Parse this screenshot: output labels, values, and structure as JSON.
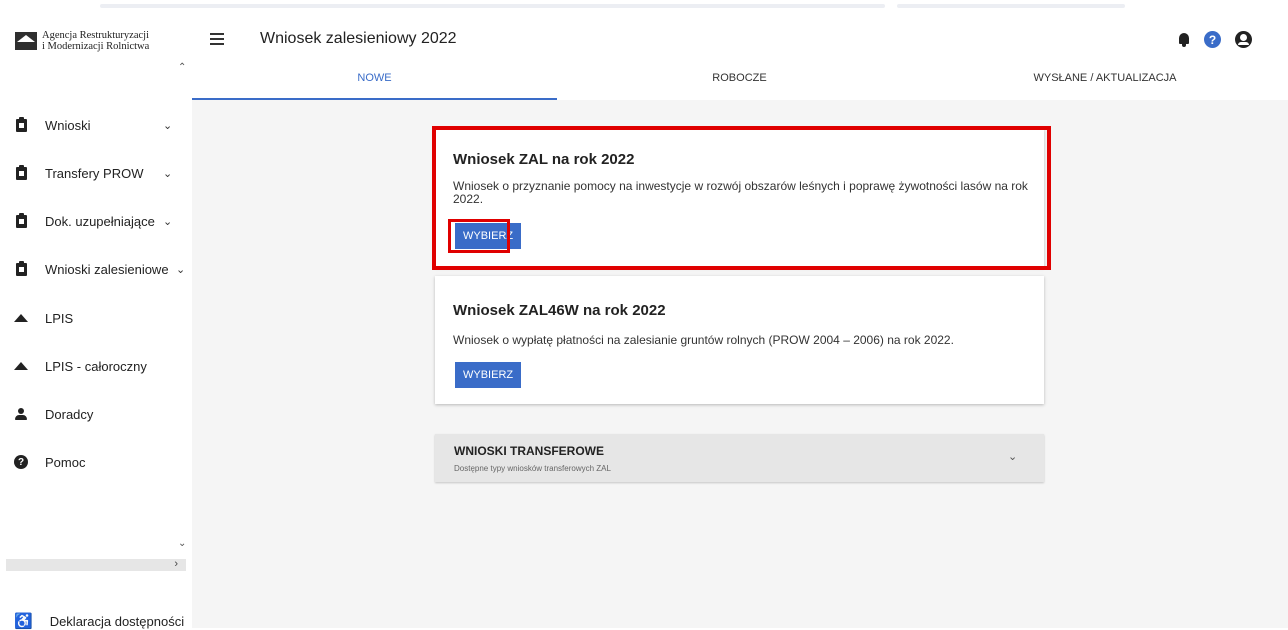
{
  "brand": {
    "line1": "Agencja Restrukturyzacji",
    "line2": "i Modernizacji Rolnictwa"
  },
  "header": {
    "title": "Wniosek zalesieniowy 2022"
  },
  "tabs": [
    {
      "label": "NOWE"
    },
    {
      "label": "ROBOCZE"
    },
    {
      "label": "WYSŁANE / AKTUALIZACJA"
    }
  ],
  "sidebar": {
    "items": [
      {
        "label": "Wnioski",
        "icon": "clipboard-icon"
      },
      {
        "label": "Transfery PROW",
        "icon": "clipboard-icon"
      },
      {
        "label": "Dok. uzupełniające",
        "icon": "clipboard-icon"
      },
      {
        "label": "Wnioski zalesieniowe",
        "icon": "clipboard-icon"
      },
      {
        "label": "LPIS",
        "icon": "mountain-icon"
      },
      {
        "label": "LPIS - całoroczny",
        "icon": "mountain-icon"
      },
      {
        "label": "Doradcy",
        "icon": "person-icon"
      },
      {
        "label": "Pomoc",
        "icon": "help-icon"
      }
    ],
    "accessibility": "Deklaracja dostępności"
  },
  "cards": [
    {
      "title": "Wniosek ZAL na rok 2022",
      "description": "Wniosek o przyznanie pomocy na inwestycje w rozwój obszarów leśnych i poprawę żywotności lasów na rok 2022.",
      "button": "WYBIERZ"
    },
    {
      "title": "Wniosek ZAL46W na rok 2022",
      "description": "Wniosek o wypłatę płatności na zalesianie gruntów rolnych (PROW 2004 – 2006) na rok 2022.",
      "button": "WYBIERZ"
    }
  ],
  "accordion": {
    "title": "WNIOSKI TRANSFEROWE",
    "subtitle": "Dostępne typy wniosków transferowych ZAL"
  },
  "colors": {
    "accent": "#3a6cc8",
    "highlight": "#e00000"
  }
}
